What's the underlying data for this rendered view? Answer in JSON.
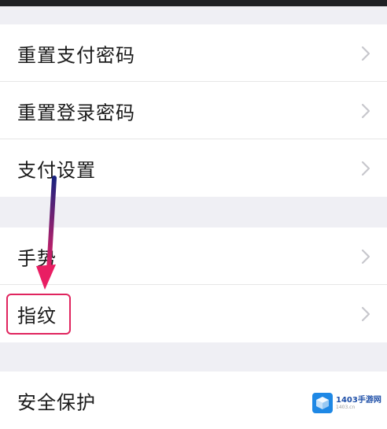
{
  "settings_groups": [
    {
      "items": [
        {
          "label": "重置支付密码"
        },
        {
          "label": "重置登录密码"
        },
        {
          "label": "支付设置"
        }
      ]
    },
    {
      "items": [
        {
          "label": "手势"
        },
        {
          "label": "指纹"
        }
      ]
    },
    {
      "items": [
        {
          "label": "安全保护"
        }
      ]
    }
  ],
  "annotation": {
    "highlight_color": "#e0245e",
    "arrow_gradient": [
      "#1a237e",
      "#e91e63"
    ]
  },
  "watermark": {
    "text": "1403手游网",
    "subtext": "1403.cn",
    "logo_color": "#1e88e5"
  }
}
